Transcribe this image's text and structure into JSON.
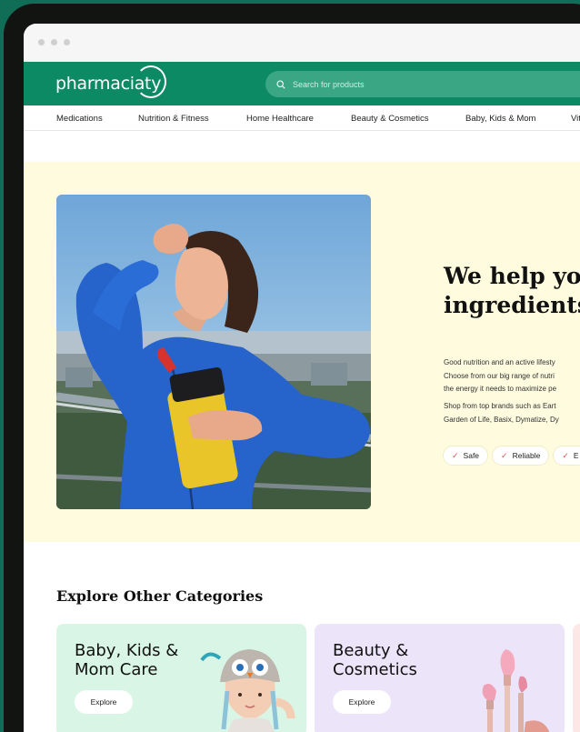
{
  "brand": {
    "logo_text": "pharmaciaty"
  },
  "search": {
    "placeholder": "Search for products"
  },
  "nav": {
    "items": [
      "Medications",
      "Nutrition & Fitness",
      "Home Healthcare",
      "Beauty & Cosmetics",
      "Baby, Kids & Mom",
      "Vita"
    ]
  },
  "hero": {
    "title_line1": "We help you",
    "title_line2": "ingredients",
    "paragraph1": [
      "Good nutrition and an active lifesty",
      "Choose from our big range of nutri",
      "the energy it needs to maximize pe"
    ],
    "paragraph2": [
      "Shop from top brands such as Eart",
      "Garden of Life, Basix, Dymatize, Dy"
    ],
    "chips": [
      "Safe",
      "Reliable",
      "E"
    ]
  },
  "categories": {
    "heading": "Explore Other Categories",
    "cards": [
      {
        "title": "Baby, Kids & Mom Care",
        "button": "Explore",
        "bg": "#d9f5e5"
      },
      {
        "title": "Beauty & Cosmetics",
        "button": "Explore",
        "bg": "#ece4f8"
      }
    ]
  },
  "colors": {
    "brand_green": "#0b8a63",
    "hero_bg": "#fefbdf",
    "frame": "#121412"
  }
}
